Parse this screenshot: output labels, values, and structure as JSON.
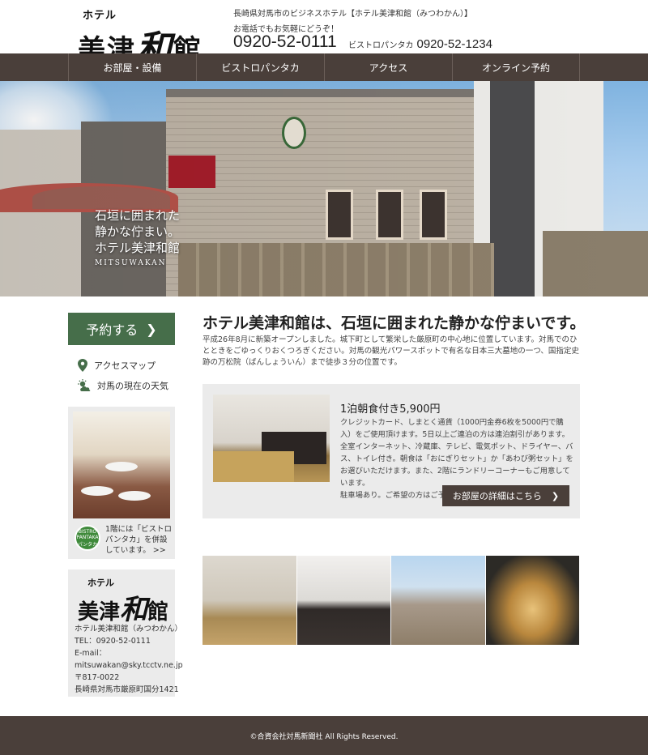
{
  "header": {
    "logo_small": "ホテル",
    "logo_big_a": "美津",
    "logo_big_b": "和",
    "logo_big_c": "館",
    "tagline": "長崎県対馬市のビジネスホテル【ホテル美津和館（みつわかん）】",
    "phone_note": "お電話でもお気軽にどうぞ！",
    "phone_main": "0920-52-0111",
    "bistro_label": "ビストロパンタカ",
    "bistro_phone": "0920-52-1234"
  },
  "nav": {
    "items": [
      {
        "label": "お部屋・設備"
      },
      {
        "label": "ビストロパンタカ"
      },
      {
        "label": "アクセス"
      },
      {
        "label": "オンライン予約"
      }
    ]
  },
  "hero": {
    "line1": "石垣に囲まれた",
    "line2": "静かな佇まい。",
    "line3": "ホテル美津和館",
    "en": "MITSUWAKAN"
  },
  "sidebar": {
    "reserve_label": "予約する",
    "access_label": "アクセスマップ",
    "weather_label": "対馬の現在の天気",
    "bistro_badge": "BISTRO PANTAKA パンタカ",
    "bistro_text": "1階には「ビストロ パンタカ」を併設しています。",
    "bistro_more": ">>",
    "addr_logo_small": "ホテル",
    "addr_logo_a": "美津",
    "addr_logo_b": "和",
    "addr_logo_c": "館",
    "addr": {
      "name": "ホテル美津和館（みつわかん）",
      "tel": "TEL：0920-52-0111",
      "email_label": "E-mail：",
      "email": "mitsuwakan@sky.tcctv.ne.jp",
      "zip": "〒817-0022",
      "address": "長崎県対馬市厳原町国分1421"
    }
  },
  "main": {
    "title": "ホテル美津和館は、石垣に囲まれた静かな佇まいです。",
    "desc": "平成26年8月に新築オープンしました。城下町として繁栄した厳原町の中心地に位置しています。対馬でのひとときをごゆっくりおくつろぎください。対馬の観光パワースポットで有名な日本三大墓地の一つ、国指定史跡の万松院（ばんしょういん）まで徒歩３分の位置です。",
    "plan": {
      "title": "1泊朝食付き5,900円",
      "body": "クレジットカード、しまとく通貨（1000円金券6枚を5000円で購入）をご使用頂けます。5日以上ご連泊の方は連泊割引があります。全室インターネット、冷蔵庫、テレビ、電気ポット、ドライヤー、バス、トイレ付き。朝食は「おにぎりセット」か「あわび粥セット」をお選びいただけます。また、2階にランドリーコーナーもご用意しています。",
      "body2": "駐車場あり。ご希望の方はご予約の際にお知らせ下さい。",
      "button": "お部屋の詳細はこちら"
    }
  },
  "footer": {
    "copyright": "©合資会社対馬新聞社 All Rights Reserved."
  },
  "colors": {
    "nav_bg": "#4a3f3a",
    "reserve_green": "#466e4a",
    "box_gray": "#ebebeb"
  },
  "icons": {
    "chevron": "chevron-right-icon",
    "map_pin": "map-pin-icon",
    "weather": "weather-icon"
  }
}
